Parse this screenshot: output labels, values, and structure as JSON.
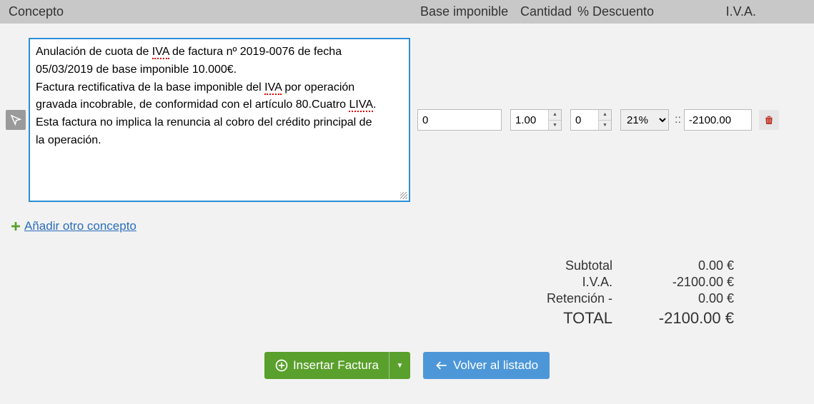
{
  "headers": {
    "concepto": "Concepto",
    "base_imponible": "Base imponible",
    "cantidad": "Cantidad",
    "descuento": "% Descuento",
    "iva": "I.V.A."
  },
  "line": {
    "concept_line1_a": "Anulación de cuota de ",
    "concept_line1_sp1": "IVA",
    "concept_line1_b": " de factura nº 2019-0076 de fecha",
    "concept_line2": "05/03/2019 de base imponible 10.000€.",
    "concept_line3_a": "Factura rectificativa de la base imponible del ",
    "concept_line3_sp1": "IVA",
    "concept_line3_b": " por operación",
    "concept_line4_a": "gravada incobrable, de conformidad con el artículo 80.Cuatro ",
    "concept_line4_sp1": "LIVA",
    "concept_line4_b": ".",
    "concept_line5": "Esta factura no implica la renuncia al cobro del crédito principal de",
    "concept_line6": "la operación.",
    "base": "0",
    "quantity": "1.00",
    "discount": "0",
    "iva_pct": "21%",
    "iva_separator": "::",
    "iva_amount": "-2100.00"
  },
  "add_link": "Añadir otro concepto",
  "totals": {
    "subtotal_label": "Subtotal",
    "subtotal_value": "0.00 €",
    "iva_label": "I.V.A.",
    "iva_value": "-2100.00 €",
    "retencion_label": "Retención -",
    "retencion_value": "0.00 €",
    "total_label": "TOTAL",
    "total_value": "-2100.00 €"
  },
  "actions": {
    "insertar": "Insertar Factura",
    "volver": "Volver al listado"
  }
}
